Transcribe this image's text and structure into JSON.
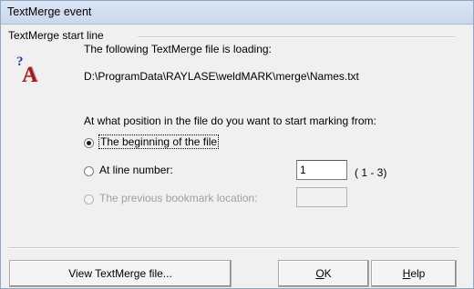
{
  "window": {
    "title": "TextMerge event"
  },
  "group": {
    "label": "TextMerge start line"
  },
  "message": {
    "loading": "The following TextMerge file is loading:",
    "path": "D:\\ProgramData\\RAYLASE\\weldMARK\\merge\\Names.txt",
    "question": "At what position in the file do you want to start marking from:"
  },
  "options": {
    "beginning": {
      "label": "The beginning of the file",
      "checked": true
    },
    "line_number": {
      "label": "At line number:",
      "checked": false,
      "value": "1",
      "range": "( 1 - 3)"
    },
    "bookmark": {
      "label": "The previous bookmark location:",
      "checked": false,
      "enabled": false,
      "value": ""
    }
  },
  "buttons": {
    "view": "View TextMerge file...",
    "ok_mnemonic": "O",
    "ok_rest": "K",
    "help_mnemonic": "H",
    "help_rest": "elp"
  },
  "icon": "question-letter-a-icon"
}
